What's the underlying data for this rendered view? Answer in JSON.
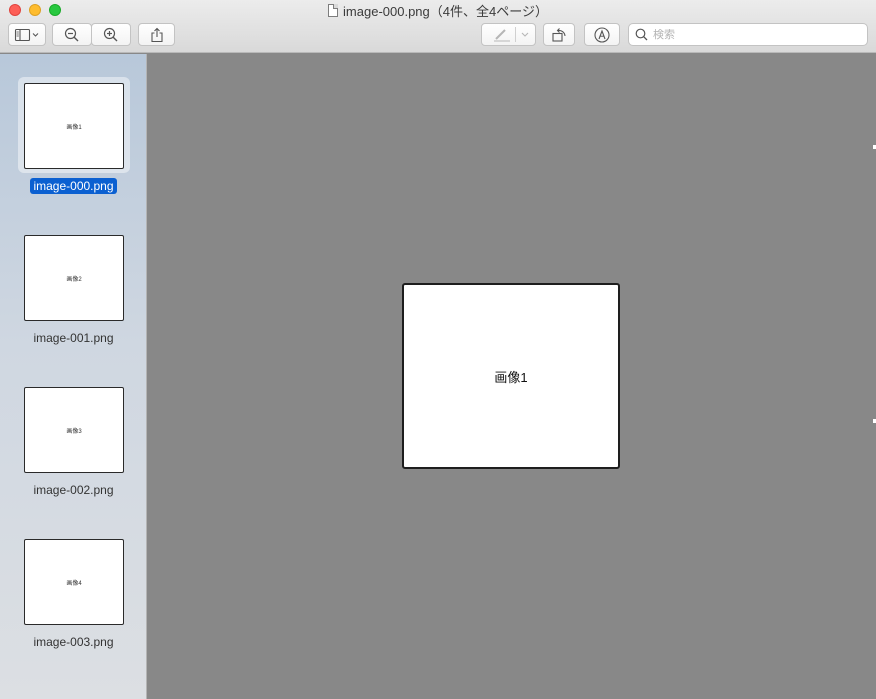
{
  "window": {
    "title": "image-000.png（4件、全4ページ）"
  },
  "toolbar": {
    "sidebar_icon": "sidebar-toggle-icon",
    "zoom_out_icon": "zoom-out-icon",
    "zoom_in_icon": "zoom-in-icon",
    "share_icon": "share-icon",
    "markup_icon": "pen-icon",
    "rotate_icon": "rotate-icon",
    "annotate_icon": "markup-circle-icon",
    "search_placeholder": "検索"
  },
  "sidebar": {
    "items": [
      {
        "filename": "image-000.png",
        "page_text": "画像1",
        "selected": true
      },
      {
        "filename": "image-001.png",
        "page_text": "画像2",
        "selected": false
      },
      {
        "filename": "image-002.png",
        "page_text": "画像3",
        "selected": false
      },
      {
        "filename": "image-003.png",
        "page_text": "画像4",
        "selected": false
      }
    ]
  },
  "main": {
    "page_text": "画像1"
  },
  "colors": {
    "selection": "#0b60d1",
    "canvas": "#888888"
  }
}
